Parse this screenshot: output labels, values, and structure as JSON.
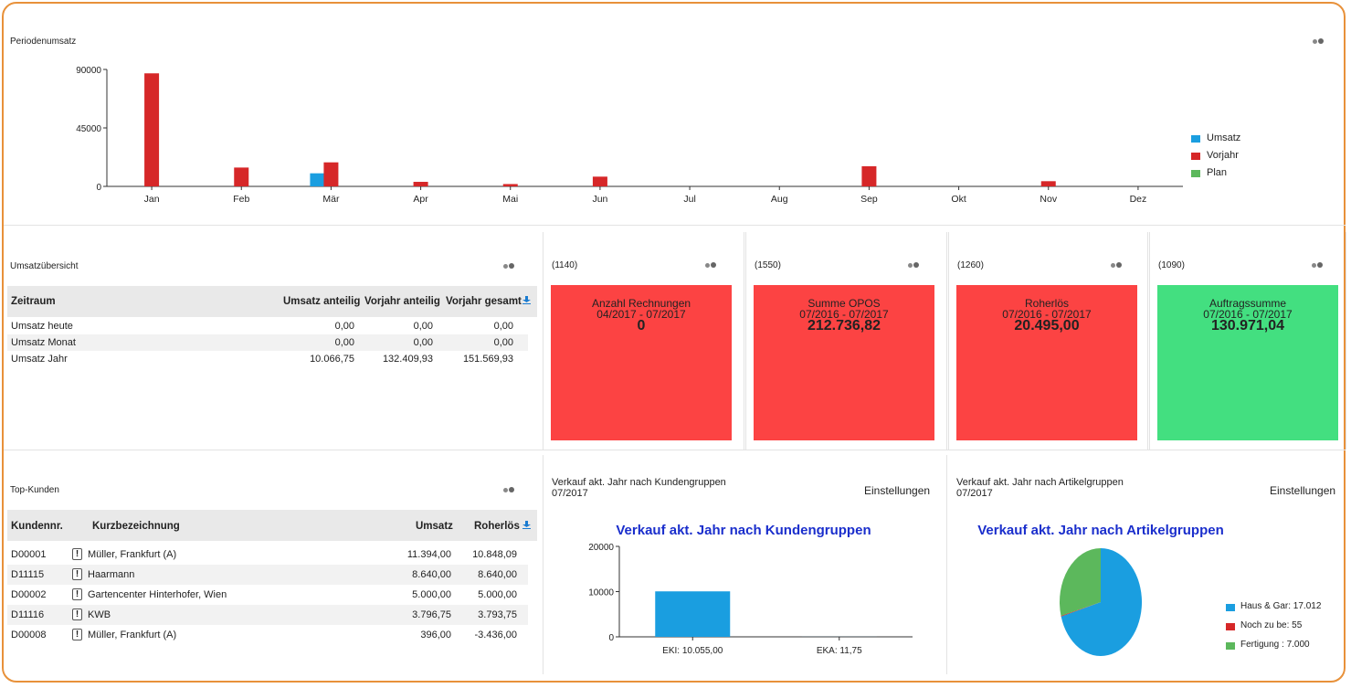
{
  "periodenumsatz": {
    "title": "Periodenumsatz",
    "chart_data": {
      "type": "bar",
      "categories": [
        "Jan",
        "Feb",
        "Mär",
        "Apr",
        "Mai",
        "Jun",
        "Jul",
        "Aug",
        "Sep",
        "Okt",
        "Nov",
        "Dez"
      ],
      "series": [
        {
          "name": "Umsatz",
          "color": "#1a9ee0",
          "values": [
            0,
            0,
            10070,
            0,
            0,
            0,
            0,
            0,
            0,
            0,
            0,
            0
          ]
        },
        {
          "name": "Vorjahr",
          "color": "#d62728",
          "values": [
            87000,
            14500,
            18500,
            3500,
            1800,
            7500,
            0,
            0,
            15500,
            0,
            4000,
            0
          ]
        },
        {
          "name": "Plan",
          "color": "#5cb85c",
          "values": [
            0,
            0,
            0,
            0,
            0,
            0,
            0,
            0,
            0,
            0,
            0,
            0
          ]
        }
      ],
      "yticks": [
        "90000",
        "45000",
        "0"
      ],
      "ylim": [
        0,
        90000
      ]
    }
  },
  "umsatzuebersicht": {
    "title": "Umsatzübersicht",
    "headers": {
      "zeitraum": "Zeitraum",
      "umsatz_anteilig": "Umsatz anteilig",
      "vorjahr_anteilig": "Vorjahr anteilig",
      "vorjahr_gesamt": "Vorjahr gesamt"
    },
    "rows": [
      {
        "label": "Umsatz heute",
        "ua": "0,00",
        "va": "0,00",
        "vg": "0,00"
      },
      {
        "label": "Umsatz Monat",
        "ua": "0,00",
        "va": "0,00",
        "vg": "0,00"
      },
      {
        "label": "Umsatz Jahr",
        "ua": "10.066,75",
        "va": "132.409,93",
        "vg": "151.569,93"
      }
    ]
  },
  "kpis": [
    {
      "code": "(1140)",
      "title": "Anzahl Rechnungen",
      "period": "04/2017 - 07/2017",
      "value": "0",
      "color": "#fc4343"
    },
    {
      "code": "(1550)",
      "title": "Summe OPOS",
      "period": "07/2016 - 07/2017",
      "value": "212.736,82",
      "color": "#fc4343"
    },
    {
      "code": "(1260)",
      "title": "Roherlös",
      "period": "07/2016 - 07/2017",
      "value": "20.495,00",
      "color": "#fc4343"
    },
    {
      "code": "(1090)",
      "title": "Auftragssumme",
      "period": "07/2016 - 07/2017",
      "value": "130.971,04",
      "color": "#43df80"
    }
  ],
  "topkunden": {
    "title": "Top-Kunden",
    "headers": {
      "nr": "Kundennr.",
      "kurz": "Kurzbezeichnung",
      "umsatz": "Umsatz",
      "roherloes": "Roherlös"
    },
    "rows": [
      {
        "nr": "D00001",
        "kurz": "Müller, Frankfurt (A)",
        "umsatz": "11.394,00",
        "roherloes": "10.848,09"
      },
      {
        "nr": "D11115",
        "kurz": "Haarmann",
        "umsatz": "8.640,00",
        "roherloes": "8.640,00"
      },
      {
        "nr": "D00002",
        "kurz": "Gartencenter Hinterhofer, Wien",
        "umsatz": "5.000,00",
        "roherloes": "5.000,00"
      },
      {
        "nr": "D11116",
        "kurz": "KWB",
        "umsatz": "3.796,75",
        "roherloes": "3.793,75"
      },
      {
        "nr": "D00008",
        "kurz": "Müller, Frankfurt (A)",
        "umsatz": "396,00",
        "roherloes": "-3.436,00"
      }
    ],
    "excl": "!"
  },
  "kundengruppen": {
    "header_line1": "Verkauf akt. Jahr nach Kundengruppen",
    "header_line2": "07/2017",
    "settings": "Einstellungen",
    "chart_data": {
      "type": "bar",
      "title": "Verkauf akt. Jahr nach Kundengruppen",
      "categories": [
        "EKI: 10.055,00",
        "EKA: 11,75"
      ],
      "values": [
        10055,
        11.75
      ],
      "yticks": [
        "20000",
        "10000",
        "0"
      ],
      "ylim": [
        0,
        20000
      ],
      "color": "#1a9ee0"
    }
  },
  "artikelgruppen": {
    "header_line1": "Verkauf akt. Jahr nach Artikelgruppen",
    "header_line2": "07/2017",
    "settings": "Einstellungen",
    "chart_data": {
      "type": "pie",
      "title": "Verkauf akt. Jahr nach Artikelgruppen",
      "labels": [
        "Haus & Gar: 17.012",
        "Noch zu be: 55",
        "Fertigung : 7.000"
      ],
      "values": [
        17012,
        55,
        7000
      ],
      "colors": [
        "#1a9ee0",
        "#d62728",
        "#5cb85c"
      ]
    }
  }
}
